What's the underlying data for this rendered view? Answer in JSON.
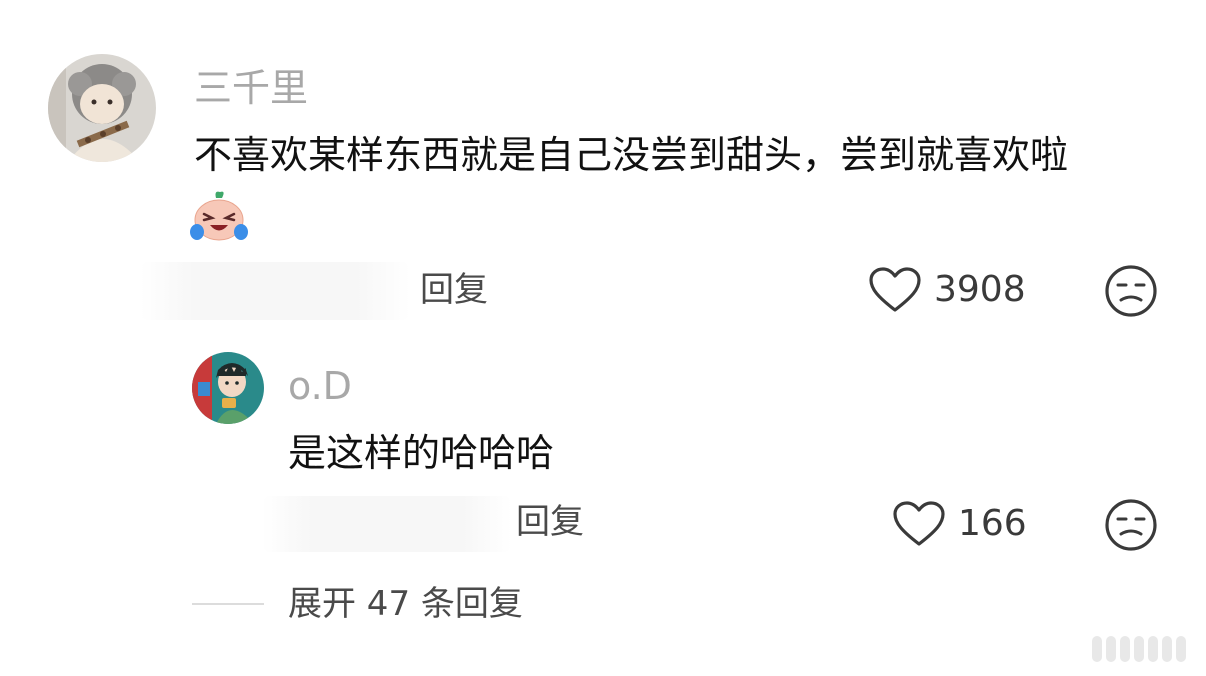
{
  "comment": {
    "username": "三千里",
    "text": "不喜欢某样东西就是自己没尝到甜头，尝到就喜欢啦",
    "emoji_icon": "laughing-crying-peach-icon",
    "reply_label": "回复",
    "like_count": "3908",
    "like_icon": "heart-outline-icon",
    "dislike_icon": "meh-face-icon"
  },
  "reply": {
    "username": "o.D",
    "text": "是这样的哈哈哈",
    "reply_label": "回复",
    "like_count": "166",
    "like_icon": "heart-outline-icon",
    "dislike_icon": "meh-face-icon"
  },
  "expand": {
    "label": "展开 47 条回复"
  },
  "colors": {
    "username": "#a8a8a8",
    "text": "#111111",
    "action": "#4a4a4a"
  }
}
